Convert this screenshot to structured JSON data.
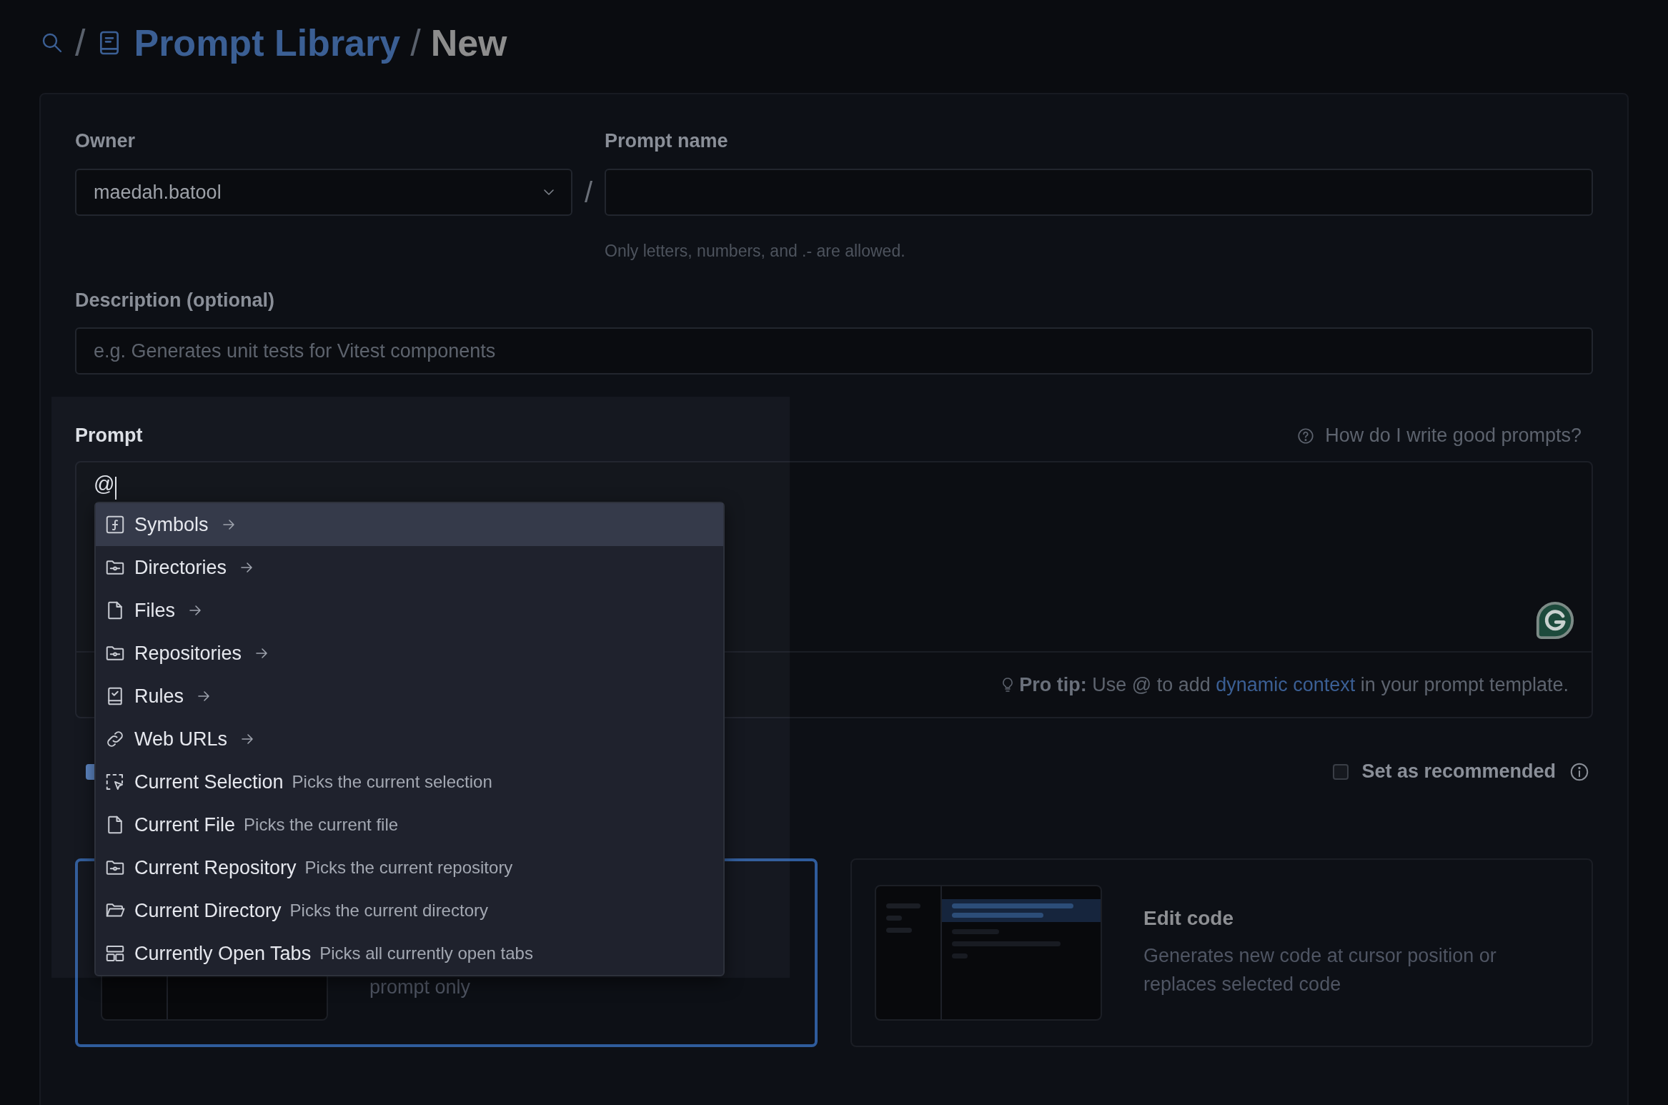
{
  "breadcrumb": [
    {
      "kind": "search"
    },
    {
      "kind": "separator",
      "text": "/"
    },
    {
      "kind": "link",
      "text": "Prompt Library"
    },
    {
      "kind": "separator",
      "text": "/"
    },
    {
      "kind": "current",
      "text": "New"
    }
  ],
  "form": {
    "owner": {
      "label": "Owner",
      "value": "maedah.batool"
    },
    "owner_separator": "/",
    "prompt_name": {
      "label": "Prompt name",
      "hint": "Only letters, numbers, and .- are allowed."
    },
    "description": {
      "label": "Description (optional)",
      "placeholder": "e.g. Generates unit tests for Vitest components"
    },
    "prompt": {
      "label": "Prompt",
      "help_link": "How do I write good prompts?",
      "value": "@",
      "pro_tip": {
        "before": "**Pro tip:** Use @ to add",
        "link": "dynamic context",
        "after": "in your prompt template."
      }
    },
    "option_checkbox": {
      "checked": true
    },
    "recommended": {
      "label": "Set as recommended",
      "checked": false
    },
    "mode_cards": [
      {
        "selected": true,
        "description": "prompt only"
      },
      {
        "selected": false,
        "title": "Edit code",
        "description": "Generates new code at cursor position or replaces selected code"
      }
    ]
  },
  "mention_menu": {
    "items": [
      {
        "kind": "category",
        "label": "Symbols",
        "selected": true
      },
      {
        "kind": "category",
        "label": "Directories",
        "selected": false
      },
      {
        "kind": "category",
        "label": "Files",
        "selected": false
      },
      {
        "kind": "category",
        "label": "Repositories",
        "selected": false
      },
      {
        "kind": "category",
        "label": "Rules",
        "selected": false
      },
      {
        "kind": "category",
        "label": "Web URLs",
        "selected": false
      },
      {
        "kind": "action",
        "label": "Current Selection",
        "description": "Picks the current selection",
        "selected": false
      },
      {
        "kind": "action",
        "label": "Current File",
        "description": "Picks the current file",
        "selected": false
      },
      {
        "kind": "action",
        "label": "Current Repository",
        "description": "Picks the current repository",
        "selected": false
      },
      {
        "kind": "action",
        "label": "Current Directory",
        "description": "Picks the current directory",
        "selected": false
      },
      {
        "kind": "action",
        "label": "Currently Open Tabs",
        "description": "Picks all currently open tabs",
        "selected": false
      }
    ]
  }
}
